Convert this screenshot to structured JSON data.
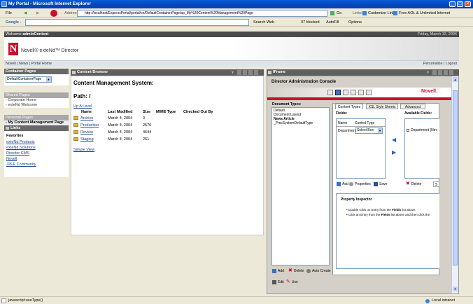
{
  "window": {
    "title": "My Portal - Microsoft Internet Explorer",
    "btn_min": "_",
    "btn_max": "□",
    "btn_close": "×"
  },
  "menubar": {
    "file": "File",
    "back": "◀",
    "forward": "▶",
    "address_label": "Address",
    "address_value": "http://localhost/ExpressPortal/portal/cn/DefaultContainerPage/ap_My%20Content%20Management%20Page",
    "go": "Go",
    "links": "Links",
    "customize_links": "Customize Links",
    "aol": "Free AOL & Unlimited Internet"
  },
  "googlebar": {
    "label": "Google -",
    "search_web": "Search Web",
    "blocked": "37 blocked",
    "autofill": "AutoFill",
    "options": "Options"
  },
  "portal": {
    "welcome_prefix": "Welcome ",
    "user": "adminContent",
    "date": "Friday, March 12, 2004",
    "brand": "Novell® exteNd™ Director",
    "nav": "Novell | News | Portal Home",
    "nav_right": "Personalize | Logout"
  },
  "sidebar": {
    "container_pages_title": "Container Pages",
    "container_select": "DefaultContainerPage",
    "shared_pages_title": "Shared Pages",
    "shared": [
      "- Corporate Home",
      "- exteNd Welcome"
    ],
    "personal_pages_title": "Personal Pages",
    "personal": [
      "- My Content Management Page"
    ],
    "links_title": "Links",
    "favorites": "Favorites",
    "links": [
      "exteNd Products",
      "exteNd Solutions",
      "Director CMS",
      "Novell",
      "J2EE Community"
    ]
  },
  "content_browser": {
    "title": "Content Browser",
    "heading": "Content Management System:",
    "path": "Path: /",
    "up_level": "Up A Level",
    "columns": [
      "Name",
      "Last Modified",
      "Size",
      "MIME Type",
      "Checked Out By"
    ],
    "rows": [
      {
        "name": "Archive",
        "modified": "March 4, 2004",
        "size": "0"
      },
      {
        "name": "Production",
        "modified": "March 4, 2004",
        "size": "2576"
      },
      {
        "name": "Review",
        "modified": "March 4, 2004",
        "size": "4644"
      },
      {
        "name": "Staging",
        "modified": "March 4, 2004",
        "size": "261"
      }
    ],
    "simple_view": "Simple View"
  },
  "iframe": {
    "title": "IFrame",
    "console_title": "Director Administration Console",
    "novell": "Novell.",
    "doc_types_label": "Document Types:",
    "doc_types": [
      "Default",
      "Document Layout",
      "News Article",
      "_PmcSystemDefaultType"
    ],
    "tabs": [
      "Content Types",
      "XSL Style Sheets",
      "Advanced"
    ],
    "fields_label": "Fields:",
    "available_fields_label": "Available Fields:",
    "field_col_name": "Name",
    "field_col_control": "Control Type",
    "field_row_name": "Department",
    "field_row_control": "Select Box",
    "available_item": "Department (Nev",
    "add": "Add",
    "properties": "Properties",
    "save": "Save",
    "delete": "Delete",
    "s": "S",
    "property_inspector": "Property Inspector",
    "pi_1_prefix": "Double Click on Entry from the ",
    "pi_1_bold": "Fields",
    "pi_1_suffix": " list above.",
    "pi_2_prefix": "Click an Entry from the ",
    "pi_2_bold": "Fields",
    "pi_2_suffix": " list above and then click the",
    "bottom_add": "Add",
    "bottom_delete": "Delete",
    "auto_create": "Auto Create",
    "edit": "Edit",
    "use": "Use"
  },
  "status": {
    "text": "javascript:useType()",
    "zone": "Local intranet"
  }
}
